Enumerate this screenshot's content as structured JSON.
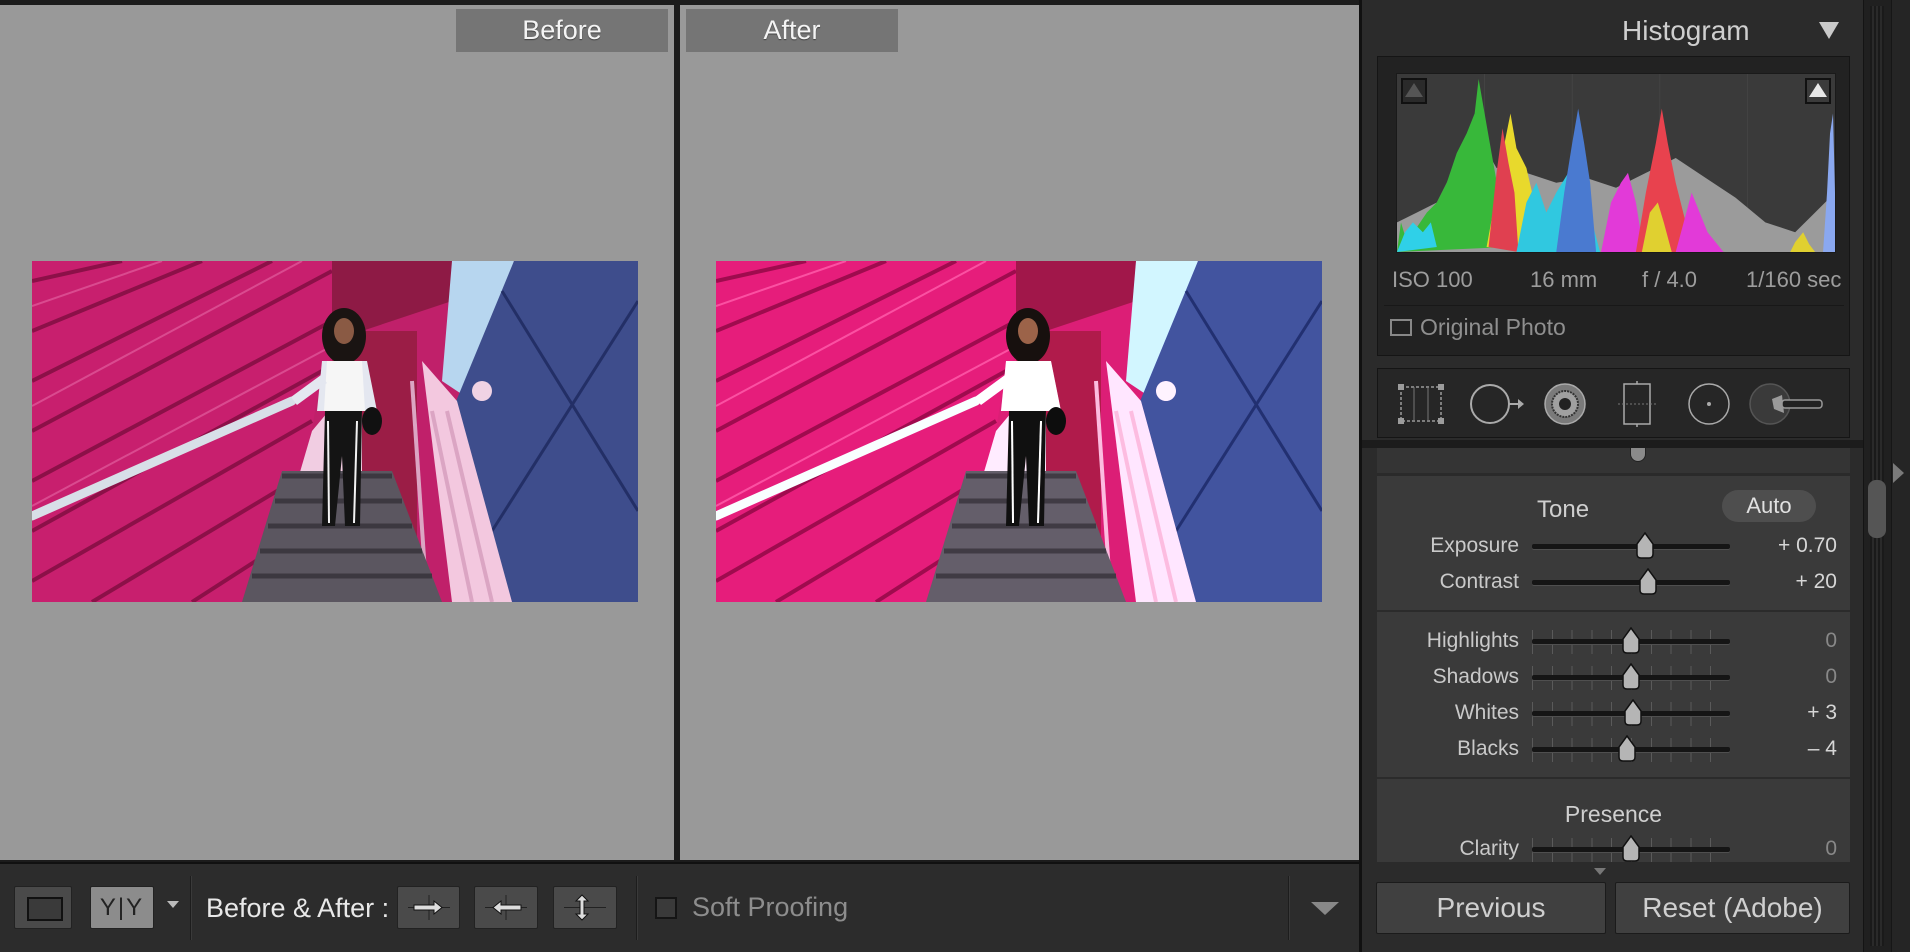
{
  "panes": {
    "before_label": "Before",
    "after_label": "After"
  },
  "toolbar": {
    "yy_label": "Y|Y",
    "before_after_label": "Before & After :",
    "soft_proofing_label": "Soft Proofing",
    "soft_proofing_checked": false
  },
  "histogram": {
    "title": "Histogram",
    "iso": "ISO 100",
    "focal_length": "16 mm",
    "aperture": "f / 4.0",
    "shutter": "1/160 sec",
    "original_photo_label": "Original Photo"
  },
  "basic": {
    "tone_label": "Tone",
    "auto_label": "Auto",
    "presence_label": "Presence",
    "sliders": [
      {
        "label": "Exposure",
        "value": "+ 0.70",
        "position": 0.57
      },
      {
        "label": "Contrast",
        "value": "+ 20",
        "position": 0.585
      },
      {
        "label": "Highlights",
        "value": "0",
        "position": 0.5
      },
      {
        "label": "Shadows",
        "value": "0",
        "position": 0.5
      },
      {
        "label": "Whites",
        "value": "+ 3",
        "position": 0.508
      },
      {
        "label": "Blacks",
        "value": "– 4",
        "position": 0.48
      },
      {
        "label": "Clarity",
        "value": "0",
        "position": 0.5
      }
    ]
  },
  "buttons": {
    "previous": "Previous",
    "reset": "Reset (Adobe)"
  },
  "colors": {
    "pane_gray": "#999999",
    "panel_bg": "#2b2b2b",
    "basic_bg": "#3a3a3a"
  }
}
